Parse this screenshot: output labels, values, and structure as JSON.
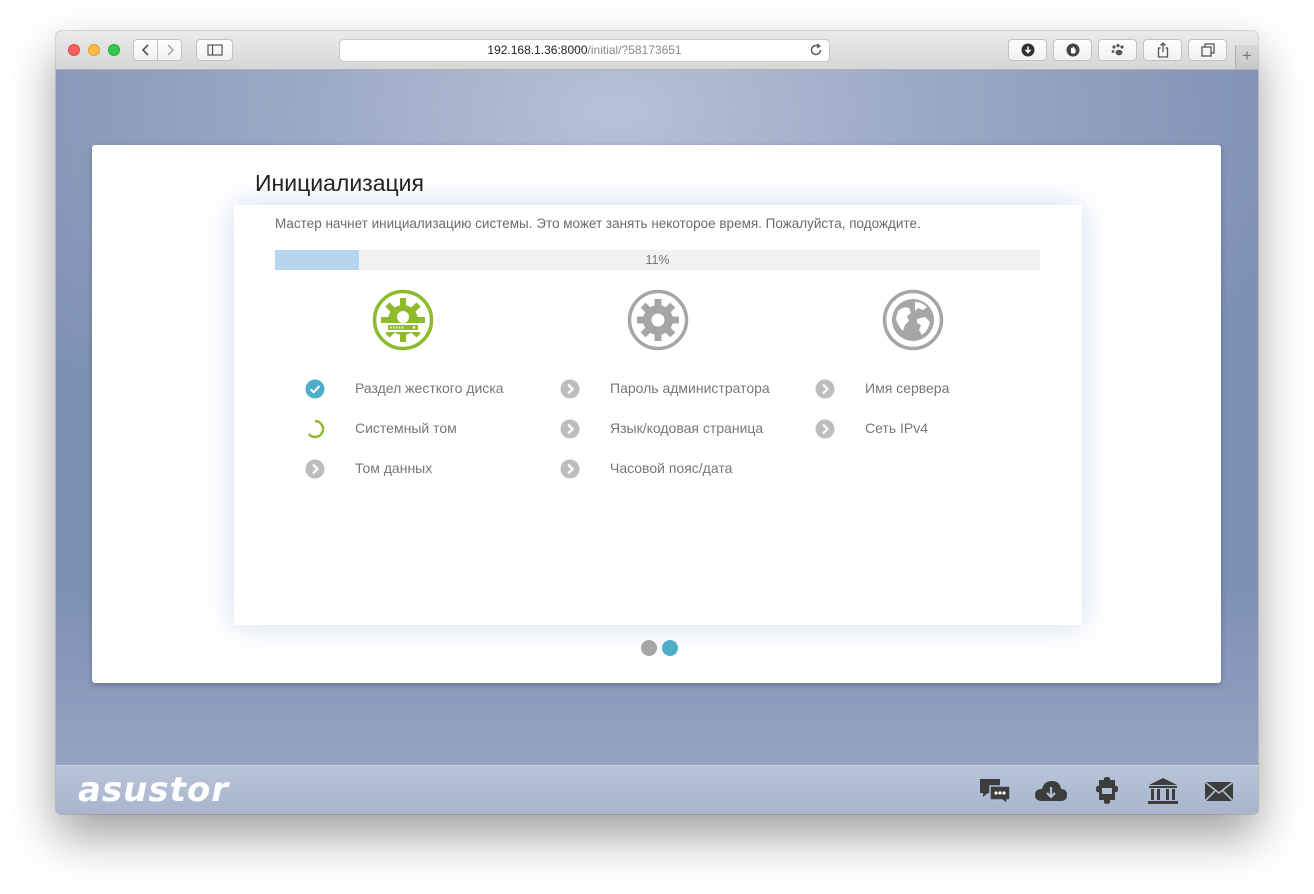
{
  "browser": {
    "url_host": "192.168.1.36:8000",
    "url_path": "/initial/?58173651"
  },
  "wizard": {
    "title": "Инициализация",
    "description": "Мастер начнет инициализацию системы. Это может занять некоторое время. Пожалуйста, подождите.",
    "progress_percent": 11,
    "progress_label": "11%",
    "columns": [
      {
        "icon": "storage-gear-icon",
        "active": true,
        "items": [
          {
            "label": "Раздел жесткого диска",
            "status": "done"
          },
          {
            "label": "Системный том",
            "status": "in-progress"
          },
          {
            "label": "Том данных",
            "status": "pending"
          }
        ]
      },
      {
        "icon": "settings-gear-icon",
        "active": false,
        "items": [
          {
            "label": "Пароль администратора",
            "status": "pending"
          },
          {
            "label": "Язык/кодовая страница",
            "status": "pending"
          },
          {
            "label": "Часовой пояс/дата",
            "status": "pending"
          }
        ]
      },
      {
        "icon": "globe-icon",
        "active": false,
        "items": [
          {
            "label": "Имя сервера",
            "status": "pending"
          },
          {
            "label": "Сеть IPv4",
            "status": "pending"
          }
        ]
      }
    ],
    "pager": {
      "pages": 2,
      "current": 2
    }
  },
  "footer": {
    "logo": "asustor",
    "icons": [
      "chat-icon",
      "cloud-download-icon",
      "plugin-icon",
      "bank-icon",
      "mail-icon"
    ]
  },
  "colors": {
    "accent_green": "#8dbb2b",
    "accent_blue": "#4eaec8",
    "inactive_gray": "#a6a6a6",
    "progress_fill": "#b8d5ef"
  }
}
